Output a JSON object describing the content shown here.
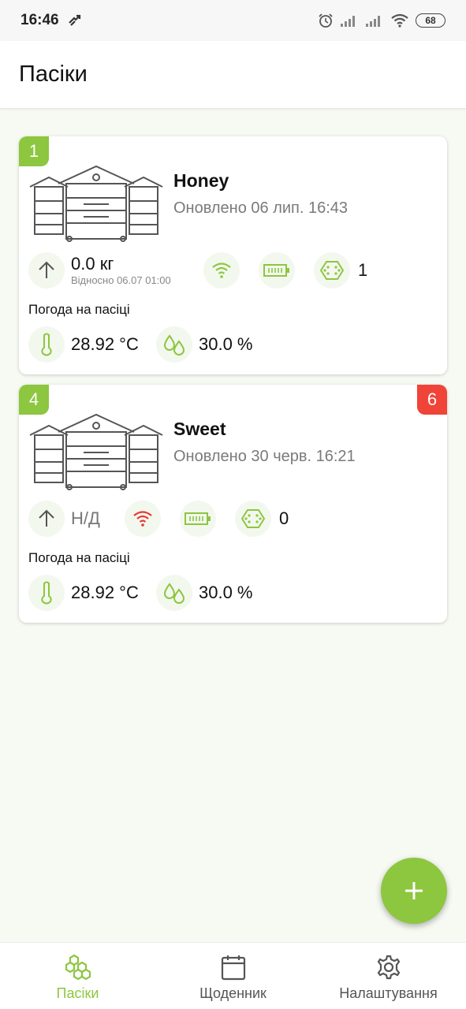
{
  "status_bar": {
    "time": "16:46",
    "battery": "68"
  },
  "app_bar": {
    "title": "Пасіки"
  },
  "apiaries": [
    {
      "badge": "1",
      "name": "Honey",
      "updated": "Оновлено 06 лип. 16:43",
      "weight": "0.0 кг",
      "weight_relative": "Відносно 06.07 01:00",
      "signal_status": "ok",
      "hive_count": "1",
      "weather_title": "Погода на пасіці",
      "temperature": "28.92 °C",
      "humidity": "30.0 %"
    },
    {
      "badge": "4",
      "alert_badge": "6",
      "name": "Sweet",
      "updated": "Оновлено 30 черв. 16:21",
      "weight": "Н/Д",
      "signal_status": "error",
      "hive_count": "0",
      "weather_title": "Погода на пасіці",
      "temperature": "28.92 °C",
      "humidity": "30.0 %"
    }
  ],
  "bottom_nav": [
    {
      "label": "Пасіки",
      "icon": "honeycomb-icon",
      "active": true
    },
    {
      "label": "Щоденник",
      "icon": "calendar-icon",
      "active": false
    },
    {
      "label": "Налаштування",
      "icon": "gear-icon",
      "active": false
    }
  ],
  "colors": {
    "accent": "#8dc63f",
    "alert": "#f04438",
    "signal_error": "#e53935"
  }
}
